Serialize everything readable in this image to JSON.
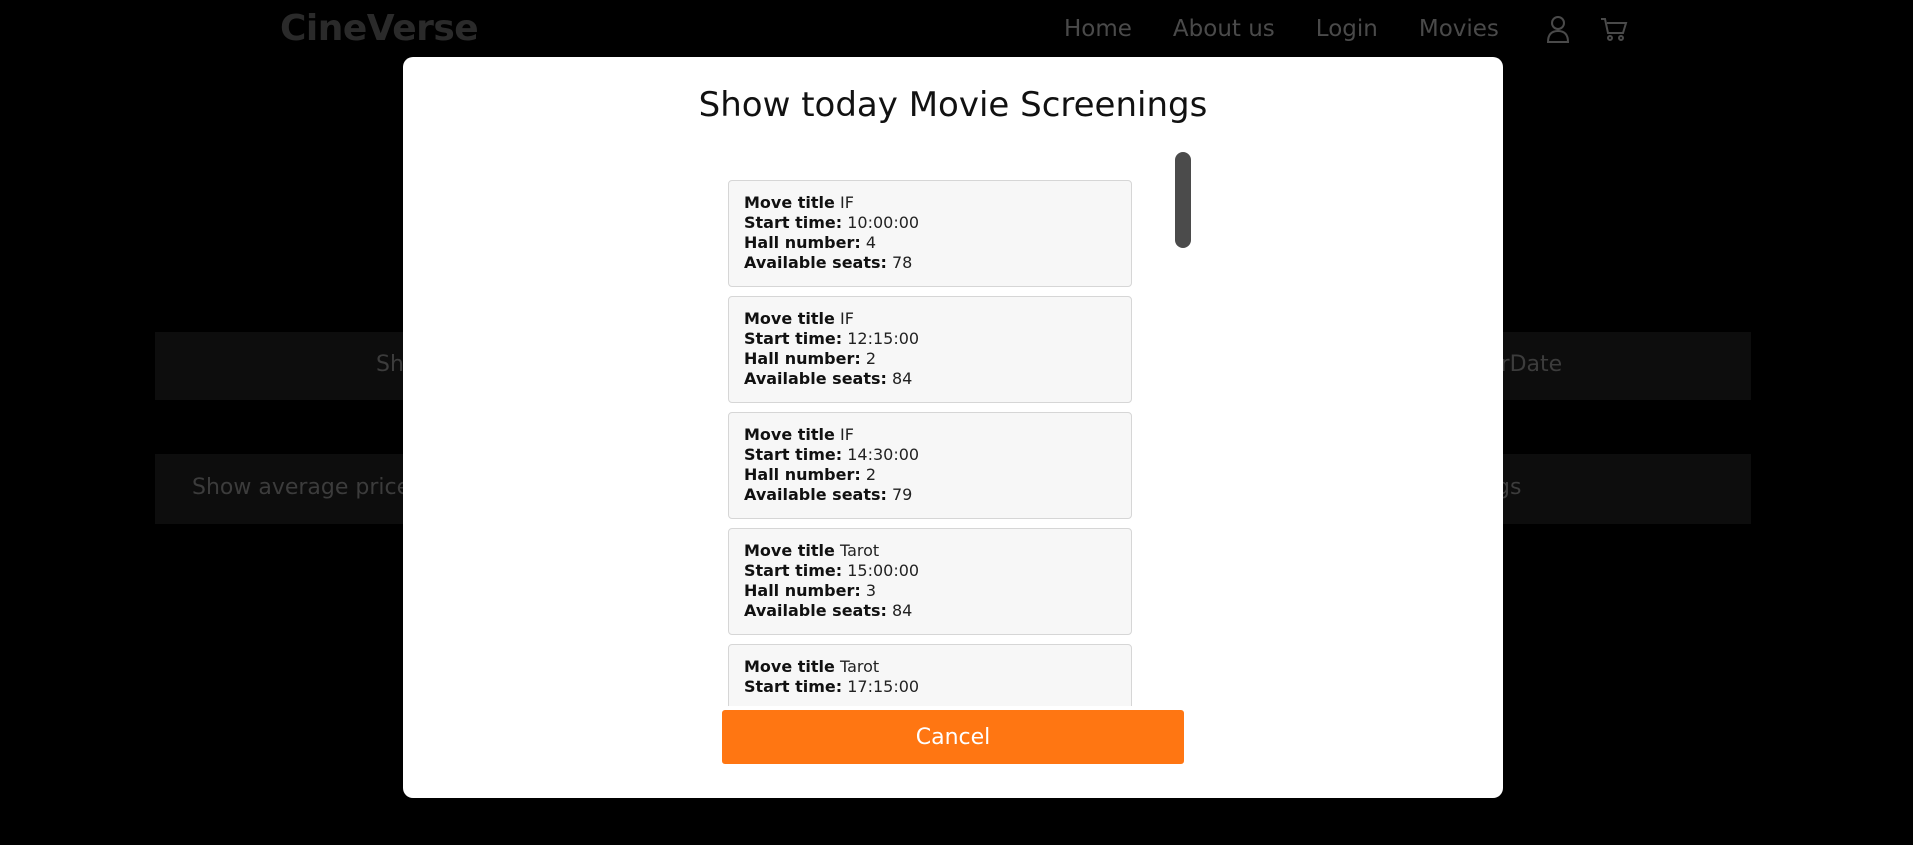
{
  "navbar": {
    "brand": "CineVerse",
    "links": [
      "Home",
      "About us",
      "Login",
      "Movies"
    ],
    "icons": [
      "user-icon",
      "cart-icon"
    ]
  },
  "background": {
    "row1_left_text": "Sh",
    "row1_right_text": "erDate",
    "row2_left_text": "Show average price",
    "row2_right_text": "gs"
  },
  "modal": {
    "title": "Show today Movie Screenings",
    "labels": {
      "title": "Move title",
      "start": "Start time:",
      "hall": "Hall number:",
      "seats": "Available seats:"
    },
    "screenings": [
      {
        "title": "IF",
        "start": "10:00:00",
        "hall": "4",
        "seats": "78"
      },
      {
        "title": "IF",
        "start": "12:15:00",
        "hall": "2",
        "seats": "84"
      },
      {
        "title": "IF",
        "start": "14:30:00",
        "hall": "2",
        "seats": "79"
      },
      {
        "title": "Tarot",
        "start": "15:00:00",
        "hall": "3",
        "seats": "84"
      },
      {
        "title": "Tarot",
        "start": "17:15:00"
      }
    ],
    "cancel_label": "Cancel"
  },
  "colors": {
    "accent": "#ff7612",
    "scrollbar": "#4b4b4b",
    "card_bg": "#f7f7f7"
  }
}
